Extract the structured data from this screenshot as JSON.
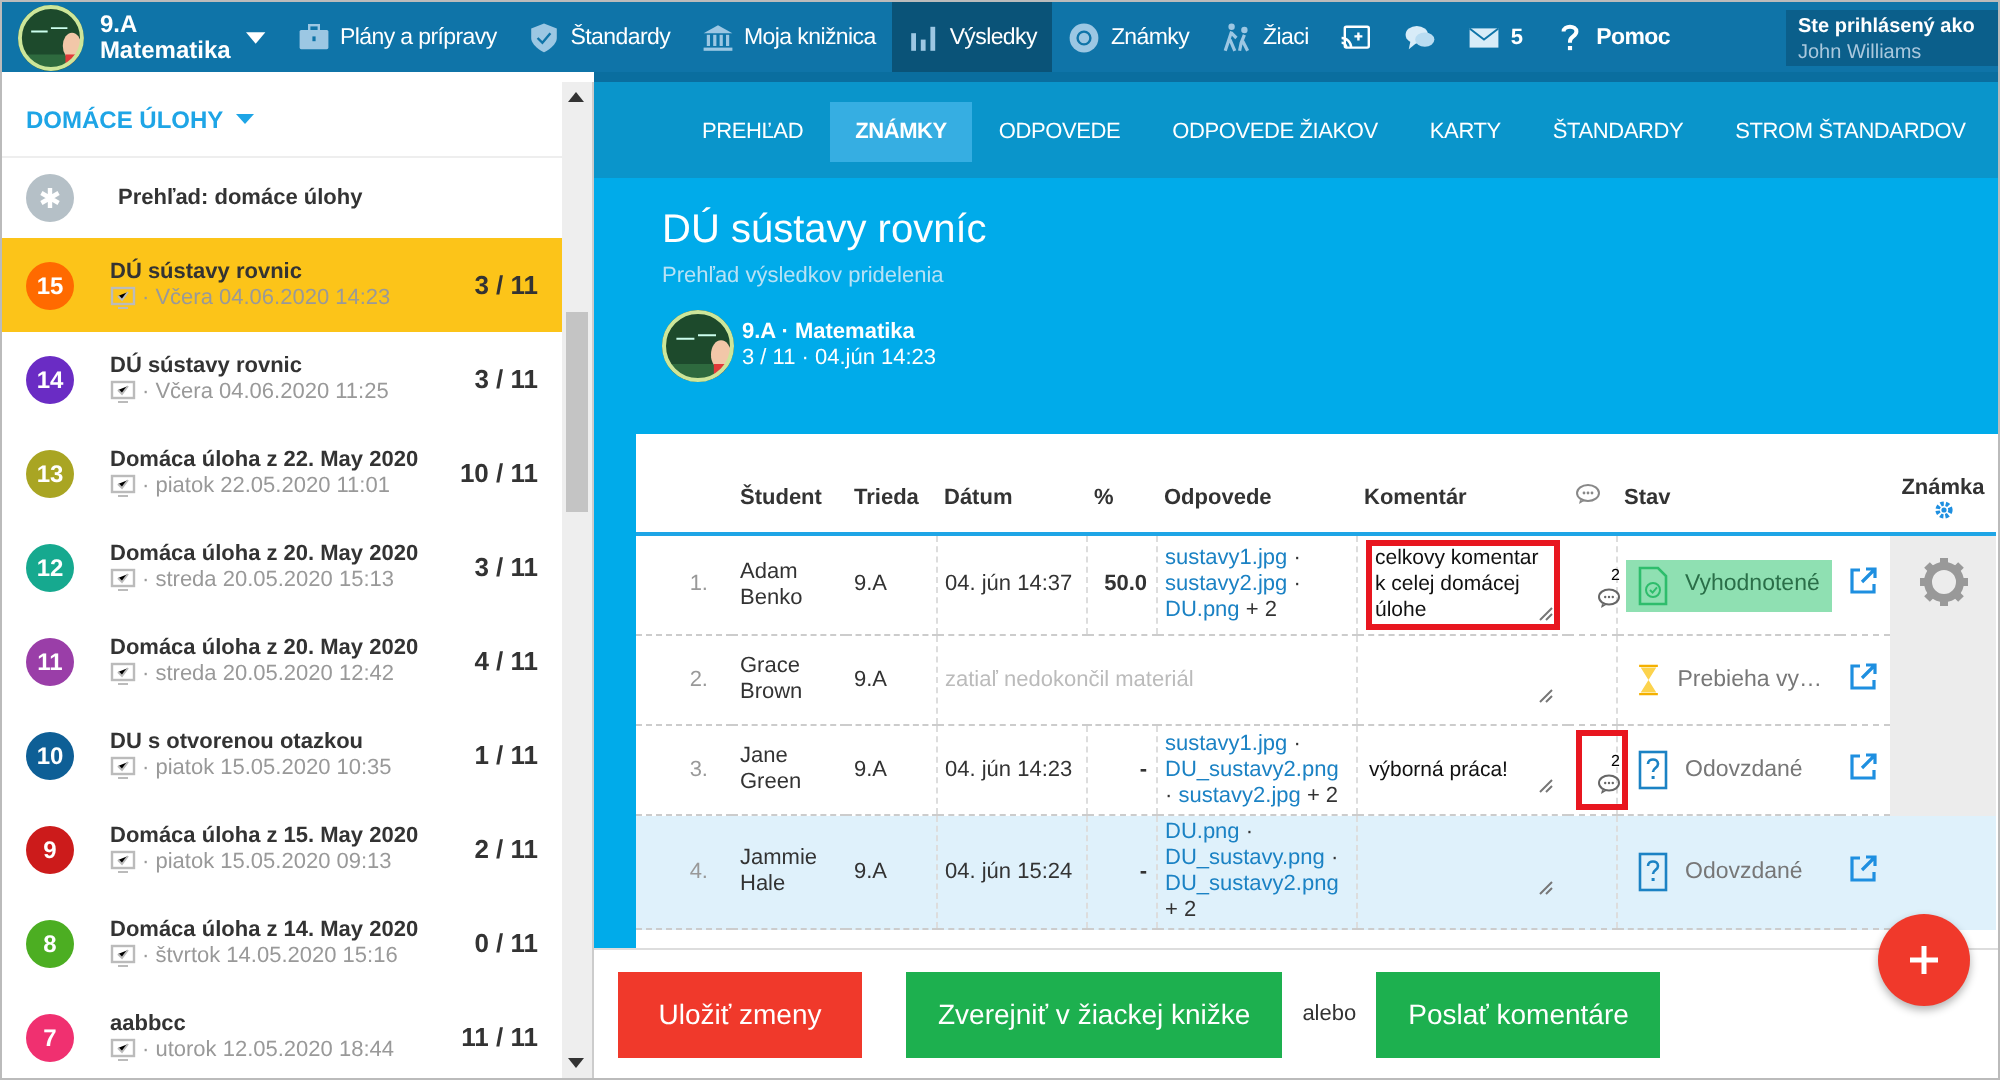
{
  "top_nav": {
    "class_selector": {
      "class": "9.A",
      "subject": "Matematika"
    },
    "items": [
      {
        "kind": "plans",
        "label": "Plány a prípravy",
        "selected": false
      },
      {
        "kind": "standards",
        "label": "Štandardy",
        "selected": false
      },
      {
        "kind": "library",
        "label": "Moja knižnica",
        "selected": false
      },
      {
        "kind": "results",
        "label": "Výsledky",
        "selected": true
      },
      {
        "kind": "grades",
        "label": "Známky",
        "selected": false
      },
      {
        "kind": "students",
        "label": "Žiaci",
        "selected": false
      },
      {
        "kind": "cast",
        "selected": false
      },
      {
        "kind": "chat",
        "selected": false
      },
      {
        "kind": "mail",
        "badge": "5",
        "selected": false
      },
      {
        "kind": "help",
        "label": "Pomoc",
        "selected": false
      }
    ],
    "user": {
      "caption": "Ste prihlásený ako",
      "name": "John Williams"
    }
  },
  "sidebar": {
    "heading": "DOMÁCE ÚLOHY",
    "overview": "Prehľad: domáce úlohy",
    "items": [
      {
        "number": "15",
        "color": "#ff6a00",
        "title": "DÚ sústavy rovnic",
        "date": "· Včera 04.06.2020 14:23",
        "count": "3 / 11",
        "selected": true
      },
      {
        "number": "14",
        "color": "#6a2cc4",
        "title": "DÚ sústavy rovnic",
        "date": "· Včera 04.06.2020 11:25",
        "count": "3 / 11",
        "selected": false
      },
      {
        "number": "13",
        "color": "#a9a523",
        "title": "Domáca úloha z 22. May 2020",
        "date": "· piatok 22.05.2020 11:01",
        "count": "10 / 11",
        "selected": false
      },
      {
        "number": "12",
        "color": "#16a98f",
        "title": "Domáca úloha z 20. May 2020",
        "date": "· streda 20.05.2020 15:13",
        "count": "3 / 11",
        "selected": false
      },
      {
        "number": "11",
        "color": "#9a3ea8",
        "title": "Domáca úloha z 20. May 2020",
        "date": "· streda 20.05.2020 12:42",
        "count": "4 / 11",
        "selected": false
      },
      {
        "number": "10",
        "color": "#0e5f96",
        "title": "DU s otvorenou otazkou",
        "date": "· piatok 15.05.2020 10:35",
        "count": "1 / 11",
        "selected": false
      },
      {
        "number": "9",
        "color": "#cc1b1b",
        "title": "Domáca úloha z 15. May 2020",
        "date": "· piatok 15.05.2020 09:13",
        "count": "2 / 11",
        "selected": false
      },
      {
        "number": "8",
        "color": "#4cae22",
        "title": "Domáca úloha z 14. May 2020",
        "date": "· štvrtok 14.05.2020 15:16",
        "count": "0 / 11",
        "selected": false
      },
      {
        "number": "7",
        "color": "#f03070",
        "title": "aabbcc",
        "date": "· utorok 12.05.2020 18:44",
        "count": "11 / 11",
        "selected": false
      }
    ]
  },
  "tabs": [
    {
      "label": "PREHĽAD",
      "selected": false
    },
    {
      "label": "ZNÁMKY",
      "selected": true
    },
    {
      "label": "ODPOVEDE",
      "selected": false
    },
    {
      "label": "ODPOVEDE ŽIAKOV",
      "selected": false
    },
    {
      "label": "KARTY",
      "selected": false
    },
    {
      "label": "ŠTANDARDY",
      "selected": false
    },
    {
      "label": "STROM ŠTANDARDOV",
      "selected": false
    }
  ],
  "assignment": {
    "title": "DÚ sústavy rovníc",
    "subtitle": "Prehľad výsledkov pridelenia",
    "class_line": "9.A · Matematika",
    "meta_line": "3 / 11 · 04.jún 14:23"
  },
  "table": {
    "columns": [
      "Študent",
      "Trieda",
      "Dátum",
      "%",
      "Odpovede",
      "Komentár",
      "Stav",
      "Známka"
    ],
    "rows": [
      {
        "number": "1.",
        "student": "Adam Benko",
        "class": "9.A",
        "date": "04. jún 14:37",
        "percent": "50.0",
        "answers": [
          {
            "kind": "file",
            "text": "sustavy1.jpg"
          },
          {
            "kind": "sep",
            "text": "·"
          },
          {
            "kind": "file",
            "text": "sustavy2.jpg"
          },
          {
            "kind": "sep",
            "text": "·"
          },
          {
            "kind": "file",
            "text": "DU.png"
          },
          {
            "kind": "more",
            "text": "+ 2"
          }
        ],
        "comment": "celkovy komentar k celej domácej úlohe",
        "comment_highlighted": true,
        "comment_count": "2",
        "count_highlighted": false,
        "status": {
          "kind": "graded",
          "label": "Vyhodnotené"
        },
        "grade_menu": true,
        "selected": false
      },
      {
        "number": "2.",
        "student": "Grace Brown",
        "class": "9.A",
        "note": "zatiaľ nedokončil materiál",
        "comment_highlighted": false,
        "count_highlighted": false,
        "status": {
          "kind": "in_progress",
          "label": "Prebieha vy…"
        },
        "grade_menu": false,
        "selected": false
      },
      {
        "number": "3.",
        "student": "Jane Green",
        "class": "9.A",
        "date": "04. jún 14:23",
        "percent": "-",
        "answers": [
          {
            "kind": "file",
            "text": "sustavy1.jpg"
          },
          {
            "kind": "sep",
            "text": "·"
          },
          {
            "kind": "file",
            "text": "DU_sustavy2.png"
          },
          {
            "kind": "sep",
            "text": "·"
          },
          {
            "kind": "file",
            "text": "sustavy2.jpg"
          },
          {
            "kind": "more",
            "text": "+ 2"
          }
        ],
        "comment": "výborná práca!",
        "comment_highlighted": false,
        "comment_count": "2",
        "count_highlighted": true,
        "status": {
          "kind": "submitted",
          "label": "Odovzdané"
        },
        "grade_menu": false,
        "selected": false
      },
      {
        "number": "4.",
        "student": "Jammie Hale",
        "class": "9.A",
        "date": "04. jún 15:24",
        "percent": "-",
        "answers": [
          {
            "kind": "file",
            "text": "DU.png"
          },
          {
            "kind": "sep",
            "text": "·"
          },
          {
            "kind": "file",
            "text": "DU_sustavy.png"
          },
          {
            "kind": "sep",
            "text": "·"
          },
          {
            "kind": "file",
            "text": "DU_sustavy2.png"
          },
          {
            "kind": "more",
            "text": "+ 2"
          }
        ],
        "comment_highlighted": false,
        "count_highlighted": false,
        "status": {
          "kind": "submitted",
          "label": "Odovzdané"
        },
        "grade_menu": false,
        "selected": true
      }
    ]
  },
  "actions": [
    {
      "kind": "danger",
      "label": "Uložiť zmeny"
    },
    {
      "kind": "success",
      "label": "Zverejniť v žiackej knižke"
    },
    {
      "kind": "text",
      "label": "alebo"
    },
    {
      "kind": "success",
      "label": "Poslať komentáre"
    }
  ]
}
